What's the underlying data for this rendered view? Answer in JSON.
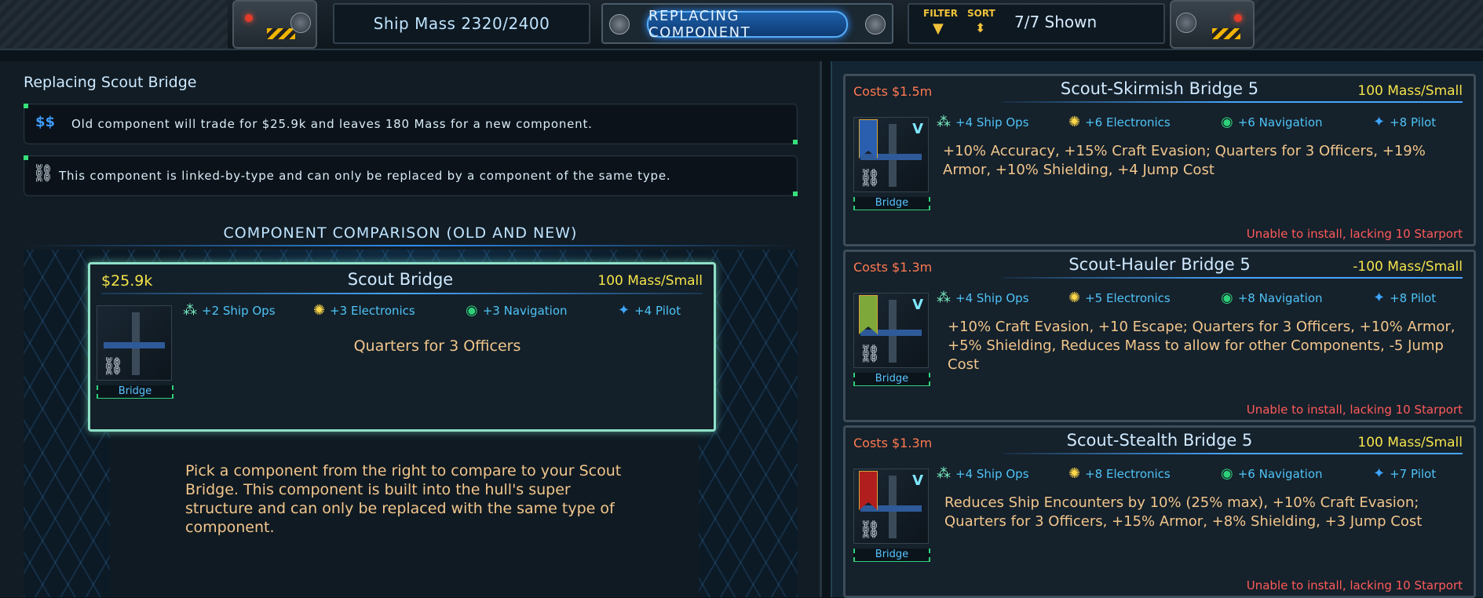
{
  "topbar": {
    "ship_mass": "Ship Mass 2320/2400",
    "mode_title": "REPLACING COMPONENT",
    "filter_label": "FILTER",
    "sort_label": "SORT",
    "shown_count": "7/7 Shown"
  },
  "left": {
    "title": "Replacing Scout Bridge",
    "trade_icon": "$$",
    "trade_text": "Old component will trade for $25.9k and leaves 180 Mass for a new component.",
    "link_text": "This component is linked-by-type and can only be replaced by a component of the same type.",
    "comparison_title": "COMPONENT COMPARISON (OLD AND NEW)",
    "old_card": {
      "price": "$25.9k",
      "name": "Scout Bridge",
      "mass": "100 Mass/Small",
      "stats": [
        {
          "icon": "ship-ops-icon",
          "label": "+2 Ship Ops"
        },
        {
          "icon": "electronics-icon",
          "label": "+3 Electronics"
        },
        {
          "icon": "navigation-icon",
          "label": "+3 Navigation"
        },
        {
          "icon": "pilot-icon",
          "label": "+4 Pilot"
        }
      ],
      "tag": "Bridge",
      "description": "Quarters for 3 Officers"
    },
    "pick_text": "Pick a component from the right to compare to your Scout Bridge. This component is built into the hull's super structure and can only be replaced with the same type of component."
  },
  "options": [
    {
      "cost": "Costs $1.5m",
      "name": "Scout-Skirmish Bridge 5",
      "mass": "100 Mass/Small",
      "stats": [
        "+4 Ship Ops",
        "+6 Electronics",
        "+6 Navigation",
        "+8 Pilot"
      ],
      "tag": "Bridge",
      "description": "+10% Accuracy, +15% Craft Evasion; Quarters for 3 Officers, +19% Armor, +10% Shielding, +4 Jump Cost",
      "warning": "Unable to install, lacking 10 Starport",
      "banner_color": "#2a5fb0"
    },
    {
      "cost": "Costs $1.3m",
      "name": "Scout-Hauler Bridge 5",
      "mass": "-100 Mass/Small",
      "stats": [
        "+4 Ship Ops",
        "+5 Electronics",
        "+8 Navigation",
        "+8 Pilot"
      ],
      "tag": "Bridge",
      "description": "+10% Craft Evasion, +10 Escape; Quarters for 3 Officers, +10% Armor, +5% Shielding, Reduces Mass to allow for other Components, -5 Jump Cost",
      "warning": "Unable to install, lacking 10 Starport",
      "banner_color": "#7ea83a"
    },
    {
      "cost": "Costs $1.3m",
      "name": "Scout-Stealth Bridge 5",
      "mass": "100 Mass/Small",
      "stats": [
        "+4 Ship Ops",
        "+8 Electronics",
        "+6 Navigation",
        "+7 Pilot"
      ],
      "tag": "Bridge",
      "description": "Reduces Ship Encounters by 10% (25% max), +10% Craft Evasion; Quarters for 3 Officers, +15% Armor, +8% Shielding, +3 Jump Cost",
      "warning": "Unable to install, lacking 10 Starport",
      "banner_color": "#b01e1e"
    }
  ]
}
